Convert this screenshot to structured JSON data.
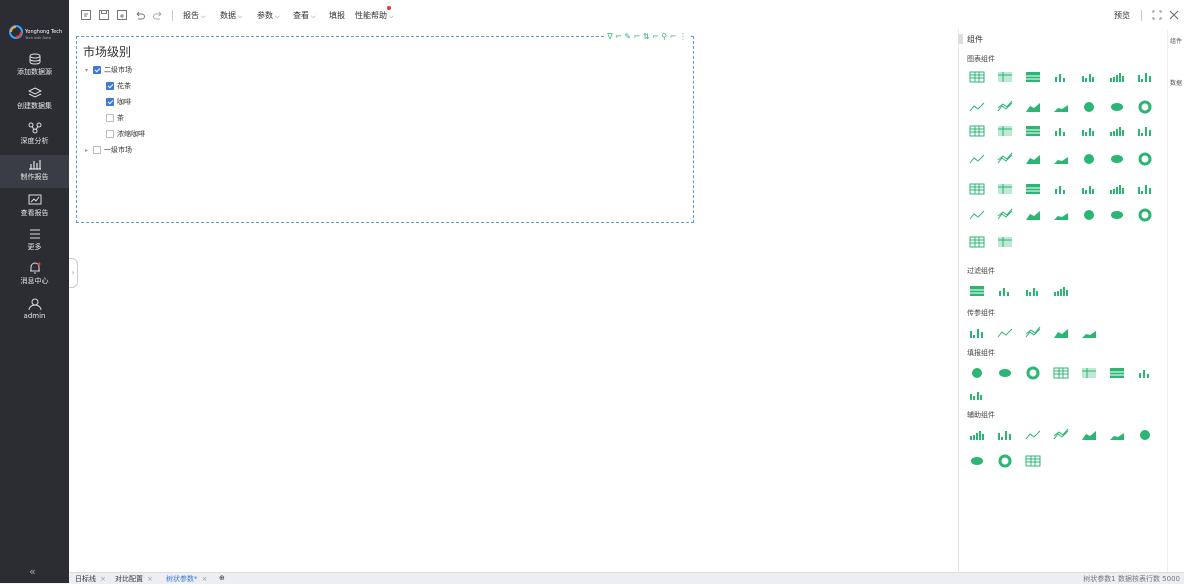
{
  "sidebar": {
    "logo_text": "Yonghong Tech",
    "logo_sub": "Tech with Data",
    "items": [
      {
        "label": "添加数据源",
        "icon": "database-icon"
      },
      {
        "label": "创建数据集",
        "icon": "layers-icon"
      },
      {
        "label": "深度分析",
        "icon": "analysis-icon"
      },
      {
        "label": "制作报告",
        "icon": "report-icon"
      },
      {
        "label": "查看报告",
        "icon": "view-report-icon"
      },
      {
        "label": "更多",
        "icon": "menu-icon"
      },
      {
        "label": "消息中心",
        "icon": "bell-icon"
      },
      {
        "label": "admin",
        "icon": "user-icon"
      }
    ],
    "collapse": "«"
  },
  "toolbar": {
    "menus": [
      "报告",
      "数据",
      "参数",
      "查看",
      "填报",
      "性能帮助"
    ],
    "preview": "预览"
  },
  "widget": {
    "title": "市场级别",
    "tools": "∇ ⌐ ✎ ⌐ ⇅ ⌐ ⚲ ⌐ ⋮",
    "tree": [
      {
        "label": "二级市场",
        "checked": true,
        "arrow": "▾"
      },
      {
        "label": "花茶",
        "checked": true
      },
      {
        "label": "咖啡",
        "checked": true
      },
      {
        "label": "茶",
        "checked": false
      },
      {
        "label": "浓缩咖啡",
        "checked": false
      },
      {
        "label": "一级市场",
        "checked": false,
        "arrow": "▸"
      }
    ]
  },
  "panel": {
    "title": "组件",
    "sections": {
      "chart": "图表组件",
      "filter": "过滤组件",
      "param": "传参组件",
      "fill": "填报组件",
      "aux": "辅助组件"
    }
  },
  "far_right": [
    "组件",
    "数据"
  ],
  "tabs": [
    {
      "label": "日标线",
      "active": false
    },
    {
      "label": "对比配置",
      "active": false
    },
    {
      "label": "树状参数*",
      "active": true
    }
  ],
  "status": "树状参数1 数据核表行数 5000",
  "colors": {
    "accent": "#2bb673",
    "sidebar": "#2b2d33",
    "blue": "#3c7ad9"
  }
}
